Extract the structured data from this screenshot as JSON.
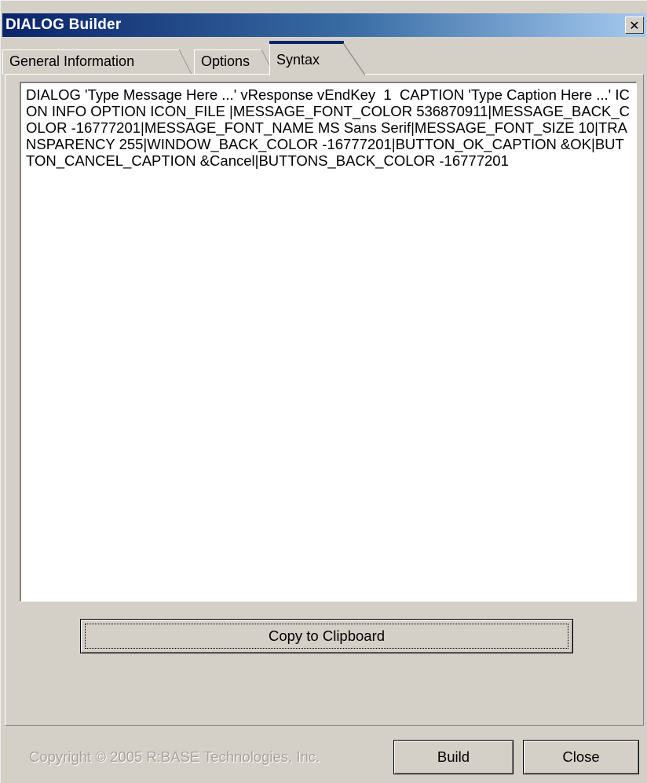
{
  "window": {
    "title": "DIALOG Builder",
    "close_glyph": "✕"
  },
  "tabs": [
    {
      "label": "General Information",
      "selected": false
    },
    {
      "label": "Options",
      "selected": false
    },
    {
      "label": "Syntax",
      "selected": true
    }
  ],
  "syntax": {
    "text": "DIALOG 'Type Message Here ...' vResponse vEndKey  1  CAPTION 'Type Caption Here ...' ICON INFO OPTION ICON_FILE |MESSAGE_FONT_COLOR 536870911|MESSAGE_BACK_COLOR -16777201|MESSAGE_FONT_NAME MS Sans Serif|MESSAGE_FONT_SIZE 10|TRANSPARENCY 255|WINDOW_BACK_COLOR -16777201|BUTTON_OK_CAPTION &OK|BUTTON_CANCEL_CAPTION &Cancel|BUTTONS_BACK_COLOR -16777201"
  },
  "buttons": {
    "copy": "Copy to Clipboard",
    "build": "Build",
    "close": "Close"
  },
  "footer": {
    "copyright": "Copyright © 2005 R:BASE Technologies, Inc."
  },
  "colors": {
    "title_start": "#0a246a",
    "title_end": "#a6caf0",
    "face": "#d4d0c8"
  }
}
